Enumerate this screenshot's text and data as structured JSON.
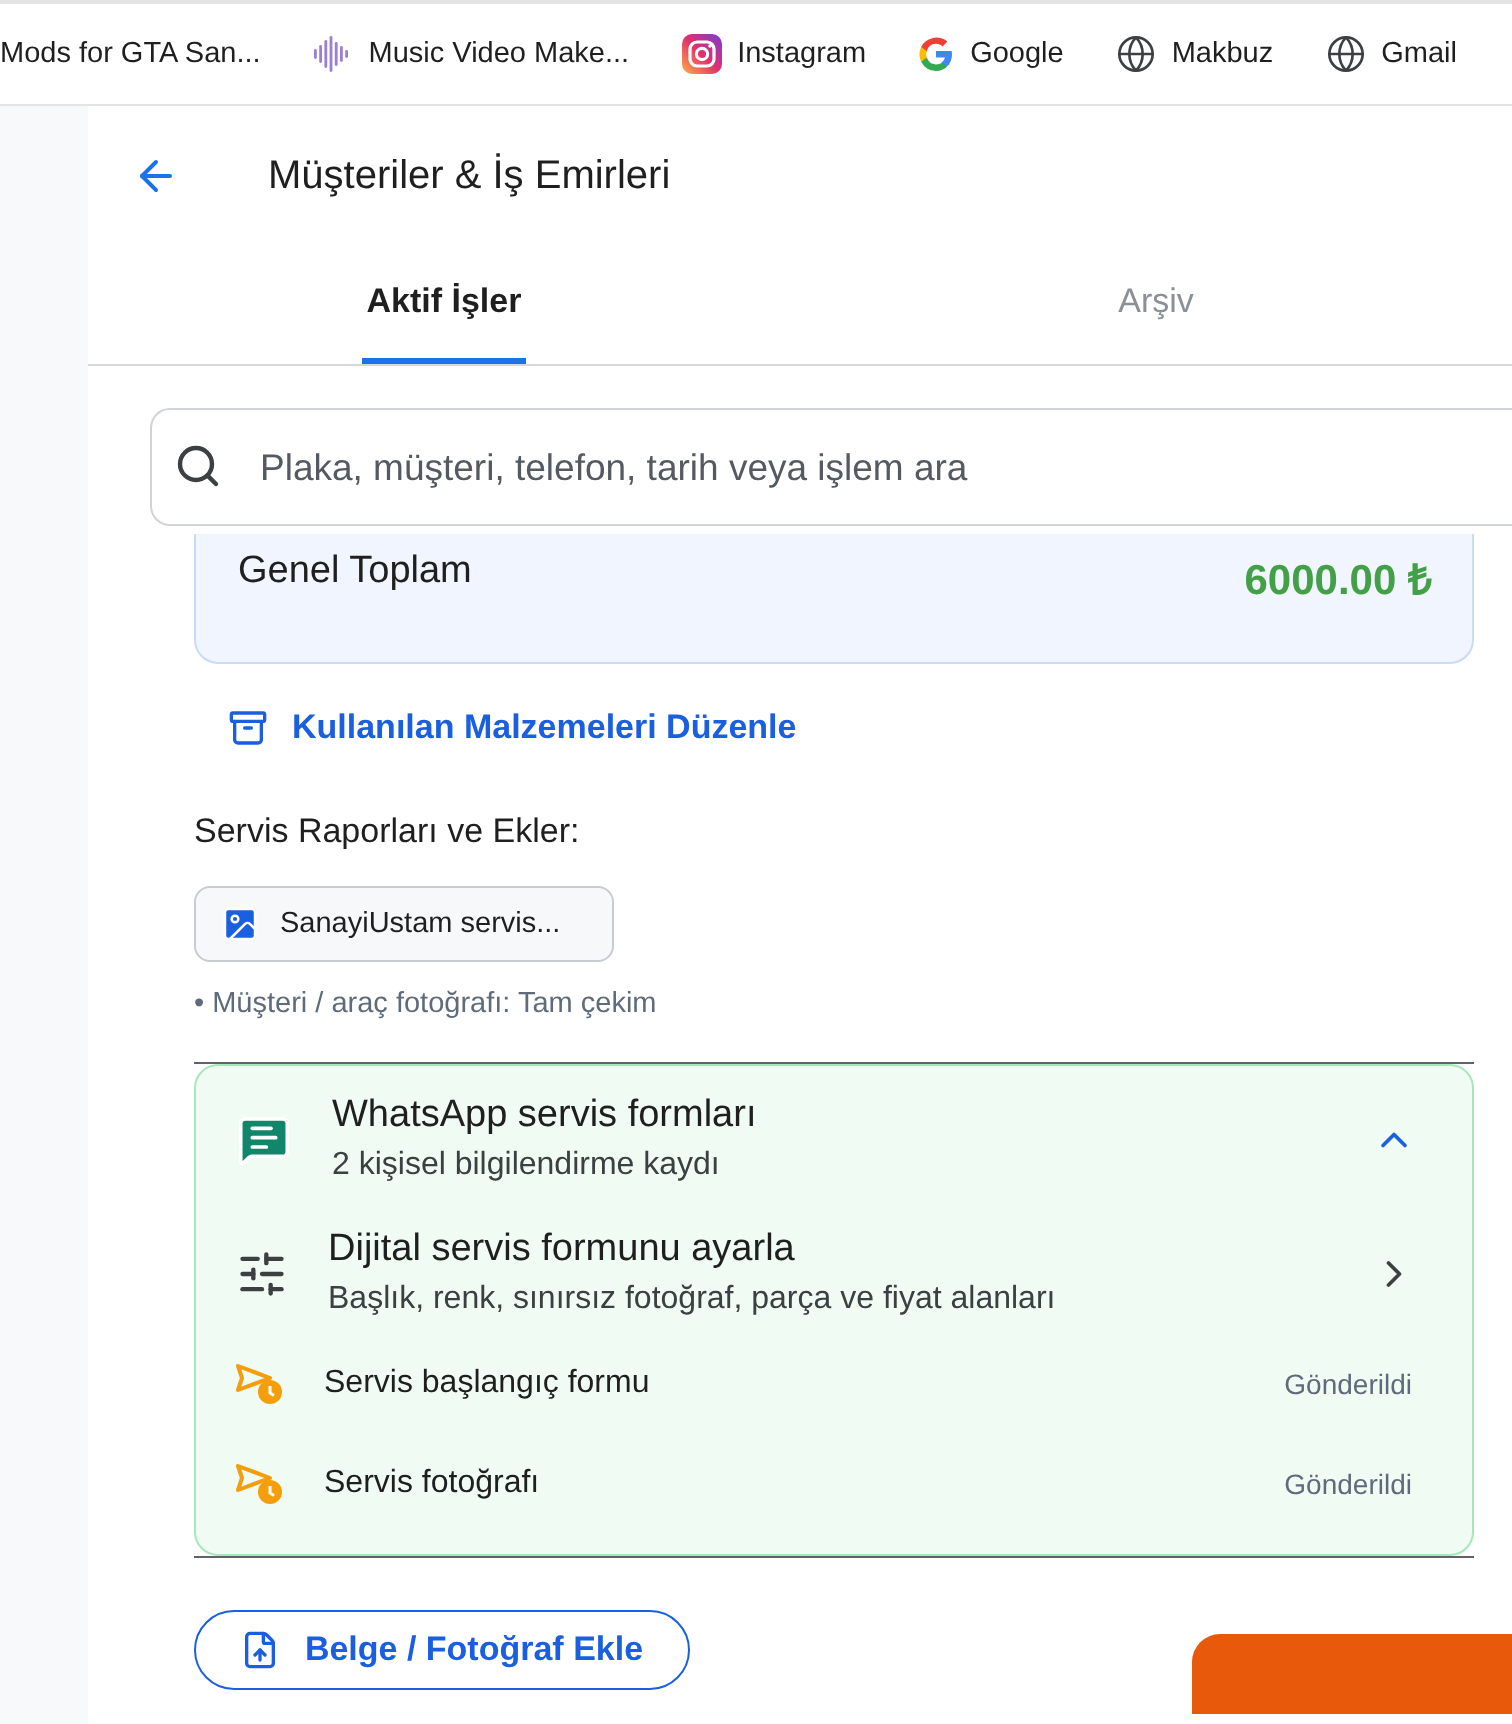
{
  "bookmarks": [
    {
      "label": "Mods for GTA San...",
      "kind": "none"
    },
    {
      "label": "Music Video Make...",
      "kind": "waveform"
    },
    {
      "label": "Instagram",
      "kind": "instagram"
    },
    {
      "label": "Google",
      "kind": "google"
    },
    {
      "label": "Makbuz",
      "kind": "globe"
    },
    {
      "label": "Gmail",
      "kind": "globe"
    }
  ],
  "header": {
    "title": "Müşteriler & İş Emirleri"
  },
  "tabs": [
    {
      "label": "Aktif İşler",
      "selected": true
    },
    {
      "label": "Arşiv",
      "selected": false
    }
  ],
  "search": {
    "placeholder": "Plaka, müşteri, telefon, tarih veya işlem ara"
  },
  "total": {
    "label": "Genel Toplam",
    "amount": "6000.00 ₺"
  },
  "materials_link": "Kullanılan Malzemeleri Düzenle",
  "attachments": {
    "title": "Servis Raporları ve Ekler:",
    "files": [
      {
        "name": "SanayiUstam servis..."
      }
    ],
    "note": "• Müşteri / araç fotoğrafı: Tam çekim"
  },
  "whatsapp": {
    "title": "WhatsApp servis formları",
    "subtitle": "2 kişisel bilgilendirme kaydı",
    "expanded": true,
    "settings": {
      "title": "Dijital servis formunu ayarla",
      "subtitle": "Başlık, renk, sınırsız fotoğraf, parça ve fiyat alanları"
    },
    "forms": [
      {
        "name": "Servis başlangıç formu",
        "status": "Gönderildi"
      },
      {
        "name": "Servis fotoğrafı",
        "status": "Gönderildi"
      }
    ]
  },
  "add_button": "Belge / Fotoğraf Ekle"
}
